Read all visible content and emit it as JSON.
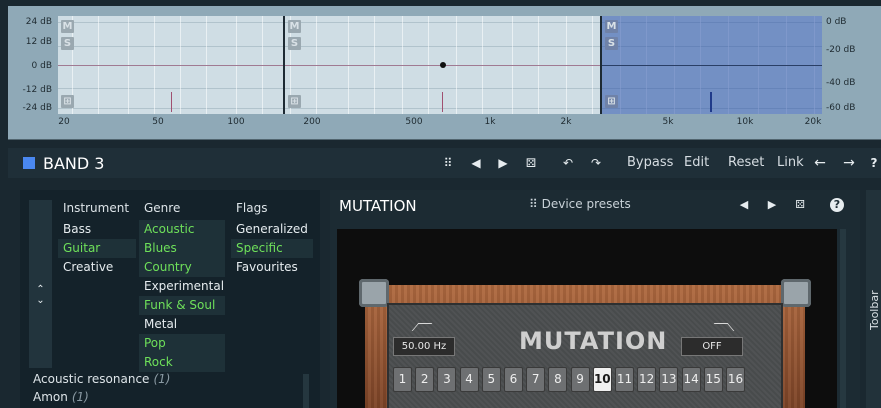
{
  "graph": {
    "db_left": [
      "24 dB",
      "12 dB",
      "0 dB",
      "-12 dB",
      "-24 dB"
    ],
    "db_right": [
      "0 dB",
      "-20 dB",
      "-40 dB",
      "-60 dB"
    ],
    "freq_labels": [
      "20",
      "50",
      "100",
      "200",
      "500",
      "1k",
      "2k",
      "5k",
      "10k",
      "20k"
    ],
    "ms_buttons": [
      "M",
      "S"
    ]
  },
  "band": {
    "title": "BAND 3",
    "color": "#4a88f0",
    "icons": [
      "grid-icon",
      "prev-arrow-icon",
      "next-arrow-icon",
      "random-icon",
      "undo-icon",
      "redo-icon"
    ],
    "bypass": "Bypass",
    "edit": "Edit",
    "reset": "Reset",
    "link": "Link"
  },
  "browser": {
    "headers": {
      "instrument": "Instrument",
      "genre": "Genre",
      "flags": "Flags"
    },
    "instrument": [
      {
        "label": "Bass",
        "green": false
      },
      {
        "label": "Guitar",
        "green": true
      },
      {
        "label": "Creative",
        "green": false
      }
    ],
    "genre": [
      {
        "label": "Acoustic",
        "green": true
      },
      {
        "label": "Blues",
        "green": true
      },
      {
        "label": "Country",
        "green": true
      },
      {
        "label": "Experimental",
        "green": false
      },
      {
        "label": "Funk & Soul",
        "green": true
      },
      {
        "label": "Metal",
        "green": false
      },
      {
        "label": "Pop",
        "green": true
      },
      {
        "label": "Rock",
        "green": true
      }
    ],
    "flags": [
      {
        "label": "Generalized",
        "green": false
      },
      {
        "label": "Specific",
        "green": true
      },
      {
        "label": "Favourites",
        "green": false
      }
    ],
    "presets": [
      {
        "name": "Acoustic resonance",
        "count": "(1)"
      },
      {
        "name": "Amon",
        "count": "(1)"
      }
    ]
  },
  "device": {
    "title": "MUTATION",
    "presets_label": "Device presets",
    "logo": "MUTATION",
    "freq_display": "50.00 Hz",
    "switch_display": "OFF",
    "buttons": [
      "1",
      "2",
      "3",
      "4",
      "5",
      "6",
      "7",
      "8",
      "9",
      "10",
      "11",
      "12",
      "13",
      "14",
      "15",
      "16"
    ],
    "active_button": "10"
  },
  "toolbar": {
    "label": "Toolbar"
  }
}
